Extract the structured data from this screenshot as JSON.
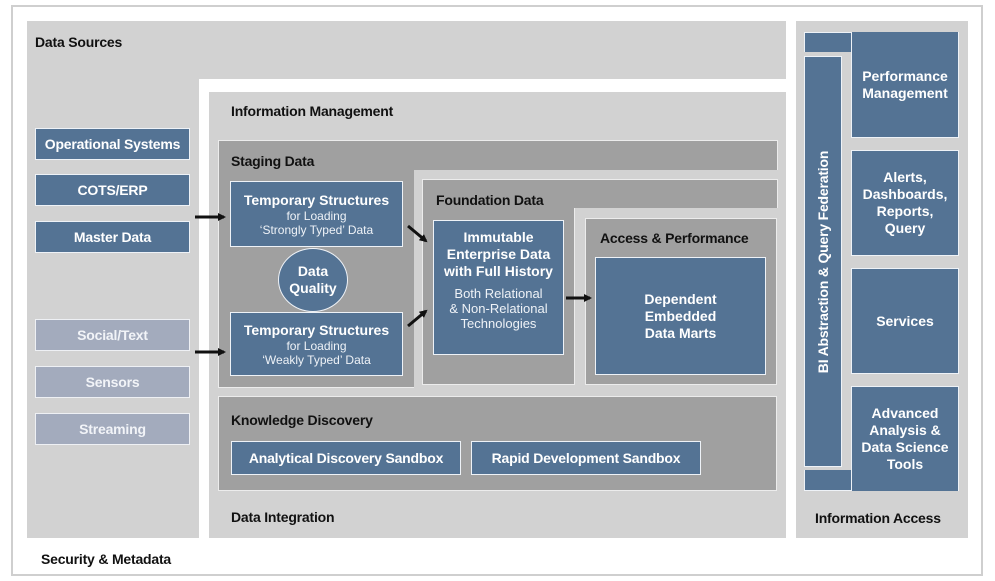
{
  "diagram": {
    "frame_title": "Security & Metadata",
    "data_sources": {
      "title": "Data Sources",
      "structured": [
        "Operational Systems",
        "COTS/ERP",
        "Master Data"
      ],
      "unstructured": [
        "Social/Text",
        "Sensors",
        "Streaming"
      ]
    },
    "information_management": {
      "title": "Information Management",
      "footer": "Data Integration",
      "staging": {
        "title": "Staging Data",
        "strong": {
          "title": "Temporary Structures",
          "line1": "for Loading",
          "line2": "‘Strongly Typed’ Data"
        },
        "quality": {
          "line1": "Data",
          "line2": "Quality"
        },
        "weak": {
          "title": "Temporary Structures",
          "line1": "for Loading",
          "line2": "‘Weakly Typed’ Data"
        }
      },
      "foundation": {
        "title": "Foundation Data",
        "box": {
          "line1": "Immutable",
          "line2": "Enterprise Data",
          "line3": "with Full History",
          "sub1": "Both Relational",
          "sub2": "& Non-Relational",
          "sub3": "Technologies"
        }
      },
      "access": {
        "title": "Access & Performance",
        "box": {
          "line1": "Dependent",
          "line2": "Embedded",
          "line3": "Data Marts"
        }
      },
      "knowledge": {
        "title": "Knowledge Discovery",
        "sandboxes": [
          "Analytical Discovery Sandbox",
          "Rapid Development Sandbox"
        ]
      }
    },
    "information_access": {
      "title": "Information Access",
      "federation": "BI Abstraction & Query Federation",
      "tools": [
        {
          "line1": "Performance",
          "line2": "Management"
        },
        {
          "line1": "Alerts,",
          "line2": "Dashboards,",
          "line3": "Reports,",
          "line4": "Query"
        },
        {
          "line1": "Services"
        },
        {
          "line1": "Advanced",
          "line2": "Analysis &",
          "line3": "Data Science",
          "line4": "Tools"
        }
      ]
    },
    "colors": {
      "box_blue": "#547394",
      "box_pale": "#a3abbd",
      "panel_light": "#d2d2d2",
      "panel_mid": "#a0a0a0"
    }
  }
}
